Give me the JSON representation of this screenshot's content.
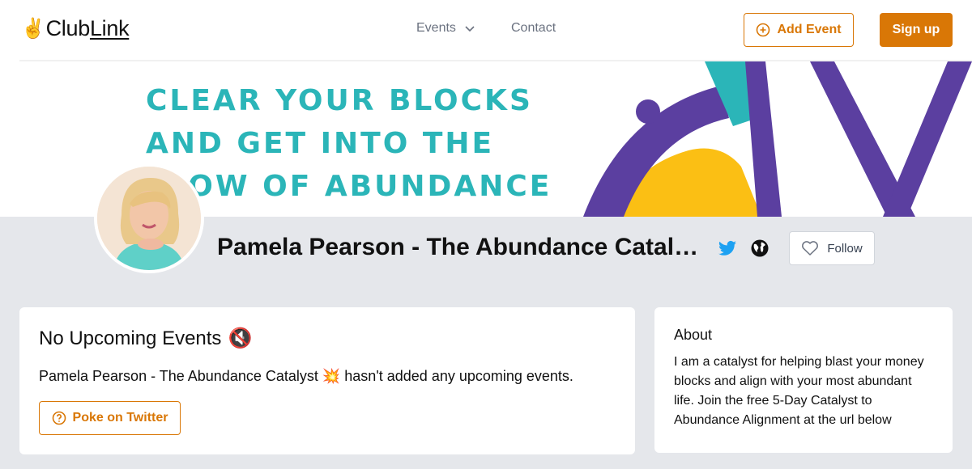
{
  "header": {
    "logo_emoji": "✌️",
    "logo_prefix": "Club",
    "logo_suffix": "Link",
    "nav_events": "Events",
    "nav_contact": "Contact",
    "add_event_label": "Add Event",
    "signup_label": "Sign up"
  },
  "banner": {
    "line1": "CLEAR YOUR BLOCKS",
    "line2": "AND GET INTO THE",
    "line3": "FLOW OF ABUNDANCE"
  },
  "profile": {
    "name": "Pamela Pearson - The Abundance Catalyst 💥",
    "follow_label": "Follow"
  },
  "events": {
    "title": "No Upcoming Events",
    "title_emoji": "🔇",
    "description": "Pamela Pearson - The Abundance Catalyst 💥 hasn't added any upcoming events.",
    "poke_label": "Poke on Twitter"
  },
  "about": {
    "title": "About",
    "text": "I am a catalyst for helping blast your money blocks and align with your most abundant life. Join the free 5-Day Catalyst to Abundance Alignment at the url below"
  },
  "colors": {
    "accent": "#d97706",
    "twitter": "#1da1f2",
    "banner_teal": "#2bb5b8",
    "banner_purple": "#5b3fa0",
    "banner_yellow": "#fbbf14"
  }
}
